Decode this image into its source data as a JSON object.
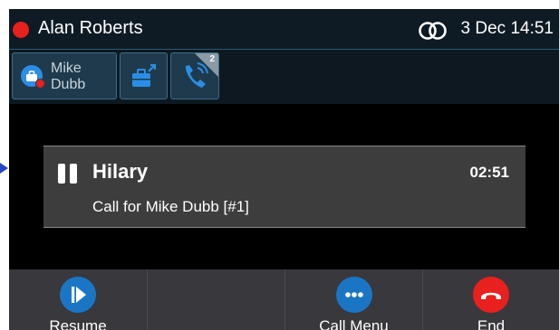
{
  "header": {
    "user_name": "Alan Roberts",
    "datetime": "3 Dec 14:51"
  },
  "line_keys": {
    "contact_name": "Mike Dubb",
    "calls_badge": "2"
  },
  "call": {
    "caller": "Hilary",
    "timer": "02:51",
    "description": "Call for Mike Dubb [#1]",
    "state_icon": "pause-icon"
  },
  "softkeys": [
    {
      "label": "Resume",
      "icon": "play-icon",
      "color": "#1a76c4"
    },
    {
      "label": "",
      "icon": "",
      "color": ""
    },
    {
      "label": "Call Menu",
      "icon": "more-icon",
      "color": "#1a76c4"
    },
    {
      "label": "End",
      "icon": "hangup-icon",
      "color": "#e8201e"
    }
  ],
  "colors": {
    "presence_busy": "#e8201e",
    "accent_blue": "#2b8ee6",
    "end_red": "#e8201e"
  }
}
